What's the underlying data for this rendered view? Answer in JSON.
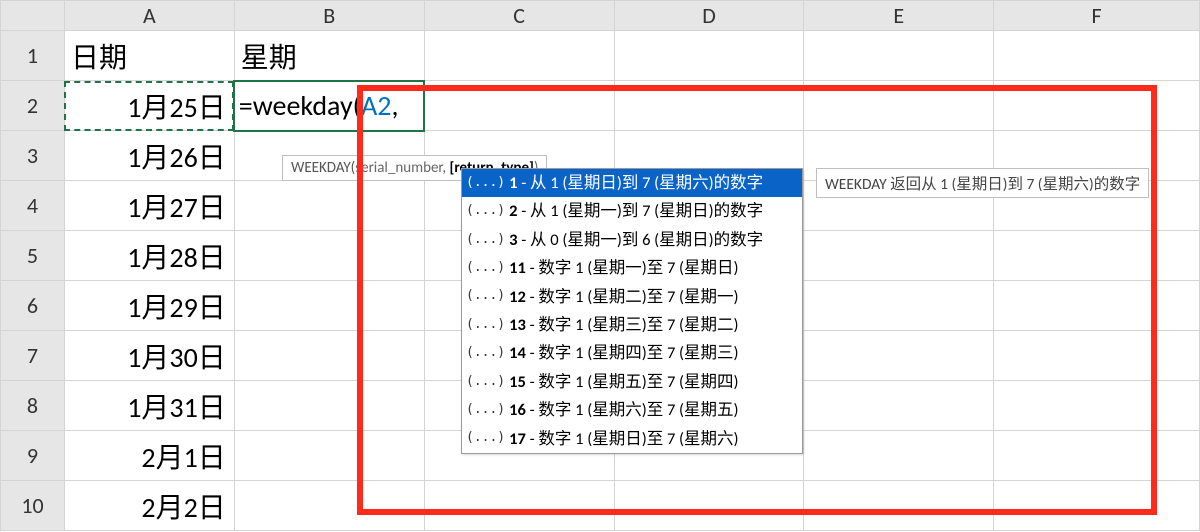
{
  "columns": [
    "A",
    "B",
    "C",
    "D",
    "E",
    "F"
  ],
  "rows": [
    "1",
    "2",
    "3",
    "4",
    "5",
    "6",
    "7",
    "8",
    "9",
    "10"
  ],
  "headers": {
    "A1": "日期",
    "B1": "星期"
  },
  "dates": [
    "1月25日",
    "1月26日",
    "1月27日",
    "1月28日",
    "1月29日",
    "1月30日",
    "1月31日",
    "2月1日",
    "2月2日"
  ],
  "formula": {
    "prefix": "=weekday(",
    "ref": "A2",
    "suffix": ","
  },
  "signature": {
    "fn": "WEEKDAY(",
    "arg1": "serial_number, ",
    "current": "[return_type]",
    "close": ")"
  },
  "ac_icon": "(...)",
  "ac": [
    {
      "num": "1",
      "rest": " - 从 1 (星期日)到 7 (星期六)的数字"
    },
    {
      "num": "2",
      "rest": " - 从 1 (星期一)到 7 (星期日)的数字"
    },
    {
      "num": "3",
      "rest": " - 从 0 (星期一)到 6 (星期日)的数字"
    },
    {
      "num": "11",
      "rest": " - 数字 1 (星期一)至 7 (星期日)"
    },
    {
      "num": "12",
      "rest": " - 数字 1 (星期二)至 7 (星期一)"
    },
    {
      "num": "13",
      "rest": " - 数字 1 (星期三)至 7 (星期二)"
    },
    {
      "num": "14",
      "rest": " - 数字 1 (星期四)至 7 (星期三)"
    },
    {
      "num": "15",
      "rest": " - 数字 1 (星期五)至 7 (星期四)"
    },
    {
      "num": "16",
      "rest": " - 数字 1 (星期六)至 7 (星期五)"
    },
    {
      "num": "17",
      "rest": " - 数字 1 (星期日)至 7 (星期六)"
    }
  ],
  "ac_selected": 0,
  "desc": "WEEKDAY 返回从 1 (星期日)到 7 (星期六)的数字"
}
